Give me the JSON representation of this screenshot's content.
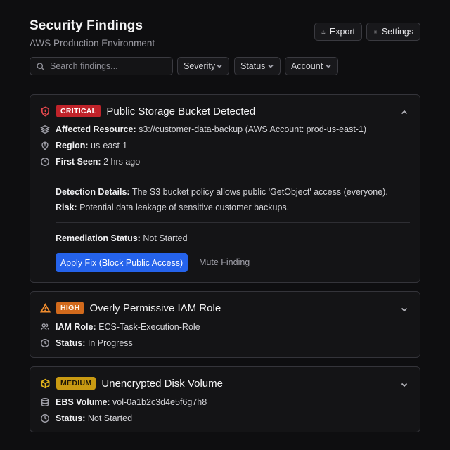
{
  "header": {
    "title": "Security Findings",
    "subtitle": "AWS Production Environment",
    "export_label": "Export",
    "settings_label": "Settings"
  },
  "toolbar": {
    "search_placeholder": "Search findings...",
    "filters": {
      "severity": "Severity",
      "status": "Status",
      "account": "Account"
    }
  },
  "colors": {
    "critical": "#c0232a",
    "high": "#d26a1c",
    "medium": "#c99a12",
    "accent": "#2563eb"
  },
  "findings": [
    {
      "severity": "CRITICAL",
      "title": "Public Storage Bucket Detected",
      "expanded": true,
      "icon": "shield-alert-icon",
      "fields": [
        {
          "icon": "layers-icon",
          "label": "Affected Resource:",
          "value": "s3://customer-data-backup (AWS Account: prod-us-east-1)"
        },
        {
          "icon": "map-pin-icon",
          "label": "Region:",
          "value": "us-east-1"
        },
        {
          "icon": "clock-icon",
          "label": "First Seen:",
          "value": "2 hrs ago"
        }
      ],
      "detection_label": "Detection Details:",
      "detection_value": "The S3 bucket policy allows public 'GetObject' access (everyone).",
      "risk_label": "Risk:",
      "risk_value": "Potential data leakage of sensitive customer backups.",
      "remediation_label": "Remediation Status:",
      "remediation_value": "Not Started",
      "primary_action": "Apply Fix (Block Public Access)",
      "secondary_action": "Mute Finding"
    },
    {
      "severity": "HIGH",
      "title": "Overly Permissive IAM Role",
      "expanded": false,
      "icon": "warning-triangle-icon",
      "fields": [
        {
          "icon": "users-icon",
          "label": "IAM Role:",
          "value": "ECS-Task-Execution-Role"
        },
        {
          "icon": "clock-icon",
          "label": "Status:",
          "value": "In Progress"
        }
      ]
    },
    {
      "severity": "MEDIUM",
      "title": "Unencrypted Disk Volume",
      "expanded": false,
      "icon": "box-icon",
      "fields": [
        {
          "icon": "database-icon",
          "label": "EBS Volume:",
          "value": "vol-0a1b2c3d4e5f6g7h8"
        },
        {
          "icon": "clock-icon",
          "label": "Status:",
          "value": "Not Started"
        }
      ]
    }
  ]
}
